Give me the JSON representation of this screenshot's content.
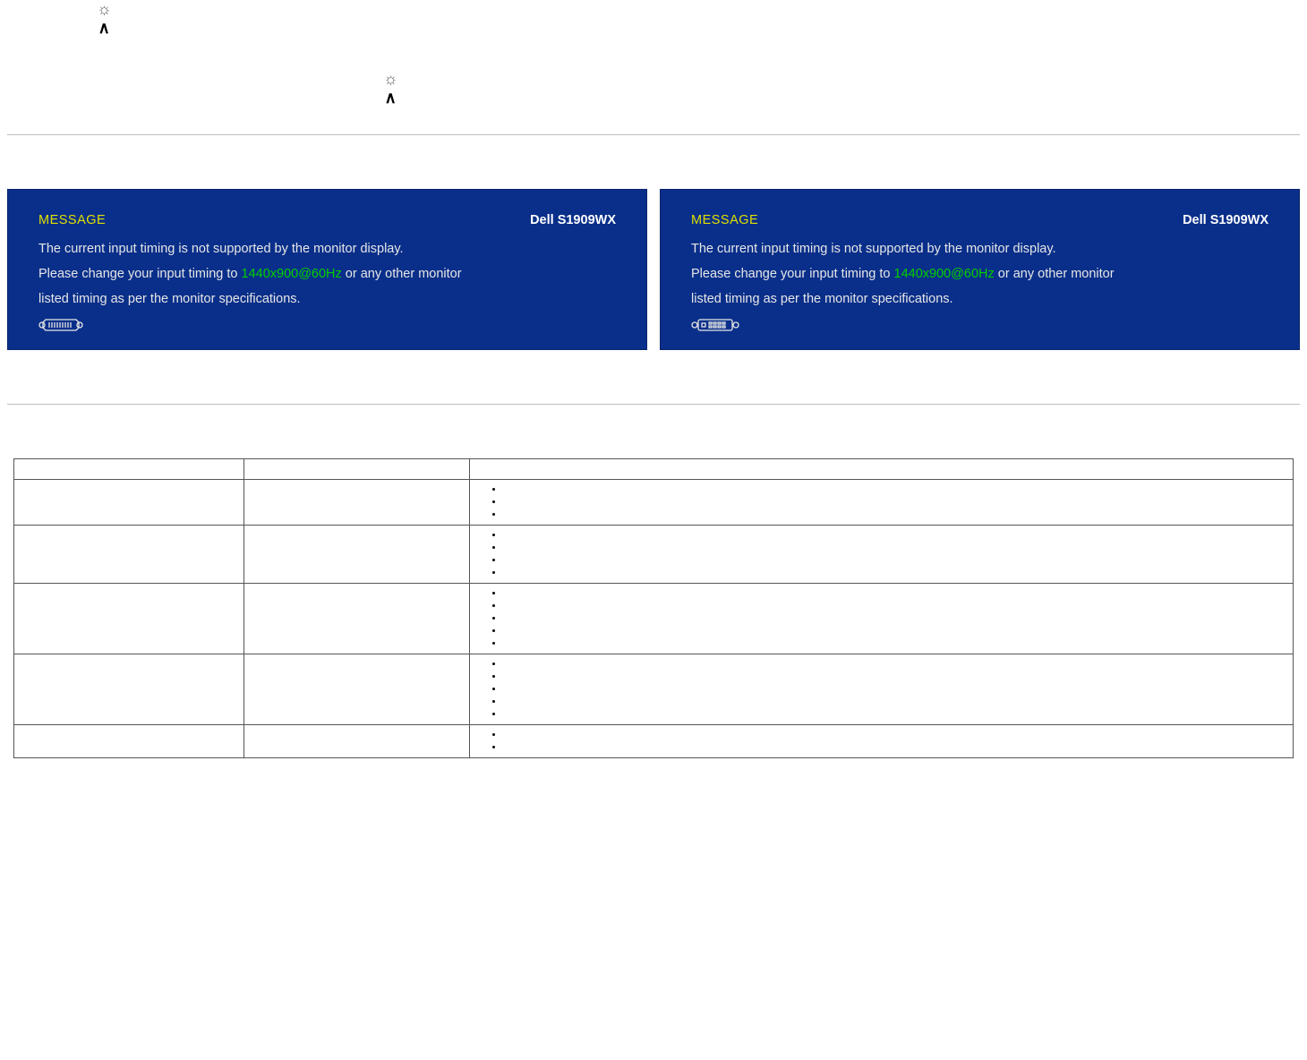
{
  "icons": {
    "sunGlyph": "☼",
    "caretGlyph": "∧"
  },
  "osd": {
    "title": "MESSAGE",
    "model": "Dell S1909WX",
    "line1_pre": " The current input timing is not supported by the monitor display.",
    "line2_pre": "Please change your input timing to ",
    "line2_hl": "1440x900@60Hz",
    "line2_post": " or any other monitor",
    "line3": "listed timing as per the monitor specifications."
  },
  "link": {
    "text": " "
  },
  "table": {
    "headers": [
      "",
      "",
      ""
    ],
    "rows": [
      {
        "c1": "",
        "c2": "",
        "items": [
          "",
          "",
          ""
        ]
      },
      {
        "c1": "",
        "c2": "",
        "items": [
          "",
          "",
          "",
          ""
        ]
      },
      {
        "c1": "",
        "c2": "",
        "items": [
          "",
          "",
          "",
          "",
          ""
        ]
      },
      {
        "c1": "",
        "c2": "",
        "items": [
          "",
          "",
          "",
          "",
          ""
        ]
      },
      {
        "c1": "",
        "c2": "",
        "items": [
          "",
          ""
        ]
      }
    ]
  }
}
